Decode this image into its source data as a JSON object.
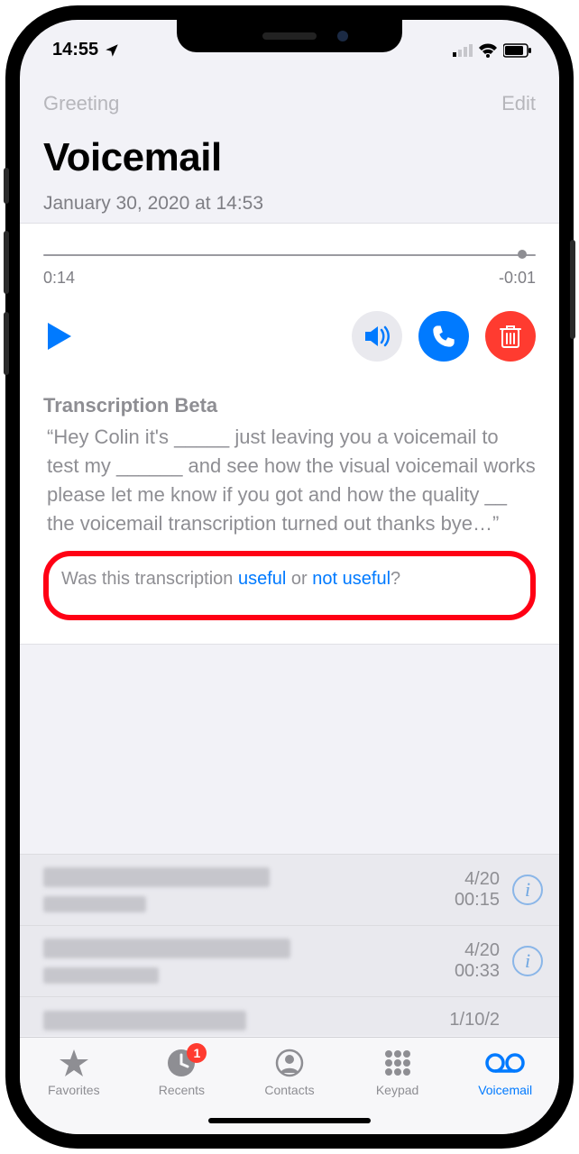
{
  "status": {
    "time": "14:55",
    "location_icon": "location-arrow",
    "cell_bars": 1,
    "wifi_bars": 3,
    "battery_pct": 85
  },
  "nav": {
    "left": "Greeting",
    "right": "Edit",
    "title": "Voicemail",
    "date": "January 30, 2020 at 14:53"
  },
  "player": {
    "elapsed": "0:14",
    "remaining": "-0:01",
    "progress": 0.93,
    "play_icon": "play",
    "speaker_icon": "speaker",
    "call_icon": "phone",
    "trash_icon": "trash"
  },
  "transcription": {
    "heading": "Transcription Beta",
    "body": "“Hey Colin it's _____ just leaving you a voicemail to test my ______ and see how the visual voicemail works please let me know if you got and how the quality __ the voicemail transcription turned out thanks bye…”"
  },
  "feedback": {
    "prefix": "Was this transcription ",
    "useful": "useful",
    "or": " or ",
    "not_useful": "not useful",
    "suffix": "?"
  },
  "list": [
    {
      "date": "4/20",
      "duration": "00:15"
    },
    {
      "date": "4/20",
      "duration": "00:33"
    },
    {
      "date": "1/10/2",
      "duration": ""
    }
  ],
  "tabs": {
    "favorites": "Favorites",
    "recents": "Recents",
    "recents_badge": "1",
    "contacts": "Contacts",
    "keypad": "Keypad",
    "voicemail": "Voicemail"
  }
}
